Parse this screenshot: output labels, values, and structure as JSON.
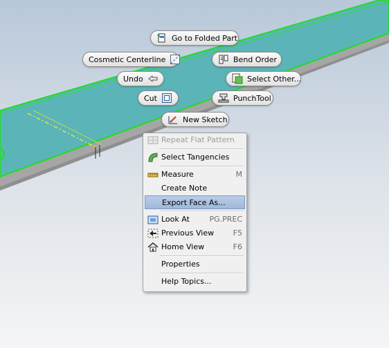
{
  "marking_menu": {
    "go_to_folded_part": "Go to Folded Part",
    "cosmetic_centerline": "Cosmetic Centerline",
    "bend_order": "Bend Order",
    "undo": "Undo",
    "select_other": "Select Other...",
    "cut": "Cut",
    "punch_tool": "PunchTool",
    "new_sketch": "New Sketch"
  },
  "context_menu": {
    "items": [
      {
        "label": "Repeat Flat Pattern",
        "shortcut": "",
        "disabled": true,
        "icon": "repeat-flat-pattern-icon"
      },
      {
        "label": "Select Tangencies",
        "shortcut": "",
        "icon": "select-tangencies-icon"
      },
      {
        "label": "Measure",
        "shortcut": "M",
        "icon": "measure-icon"
      },
      {
        "label": "Create Note",
        "shortcut": ""
      },
      {
        "label": "Export Face As...",
        "shortcut": "",
        "highlighted": true
      },
      {
        "label": "Look At",
        "shortcut": "PG.PREC",
        "icon": "look-at-icon"
      },
      {
        "label": "Previous View",
        "shortcut": "F5",
        "icon": "previous-view-icon"
      },
      {
        "label": "Home View",
        "shortcut": "F6",
        "icon": "home-view-icon"
      },
      {
        "label": "Properties",
        "shortcut": ""
      },
      {
        "label": "Help Topics...",
        "shortcut": ""
      }
    ]
  },
  "colors": {
    "part_face": "#5bb5b8",
    "part_edge_highlight": "#22dd22",
    "part_side": "#a9a9a9",
    "background_top": "#b8c8d9",
    "background_bottom": "#f4f5f6",
    "menu_highlight": "#a9c0de"
  }
}
